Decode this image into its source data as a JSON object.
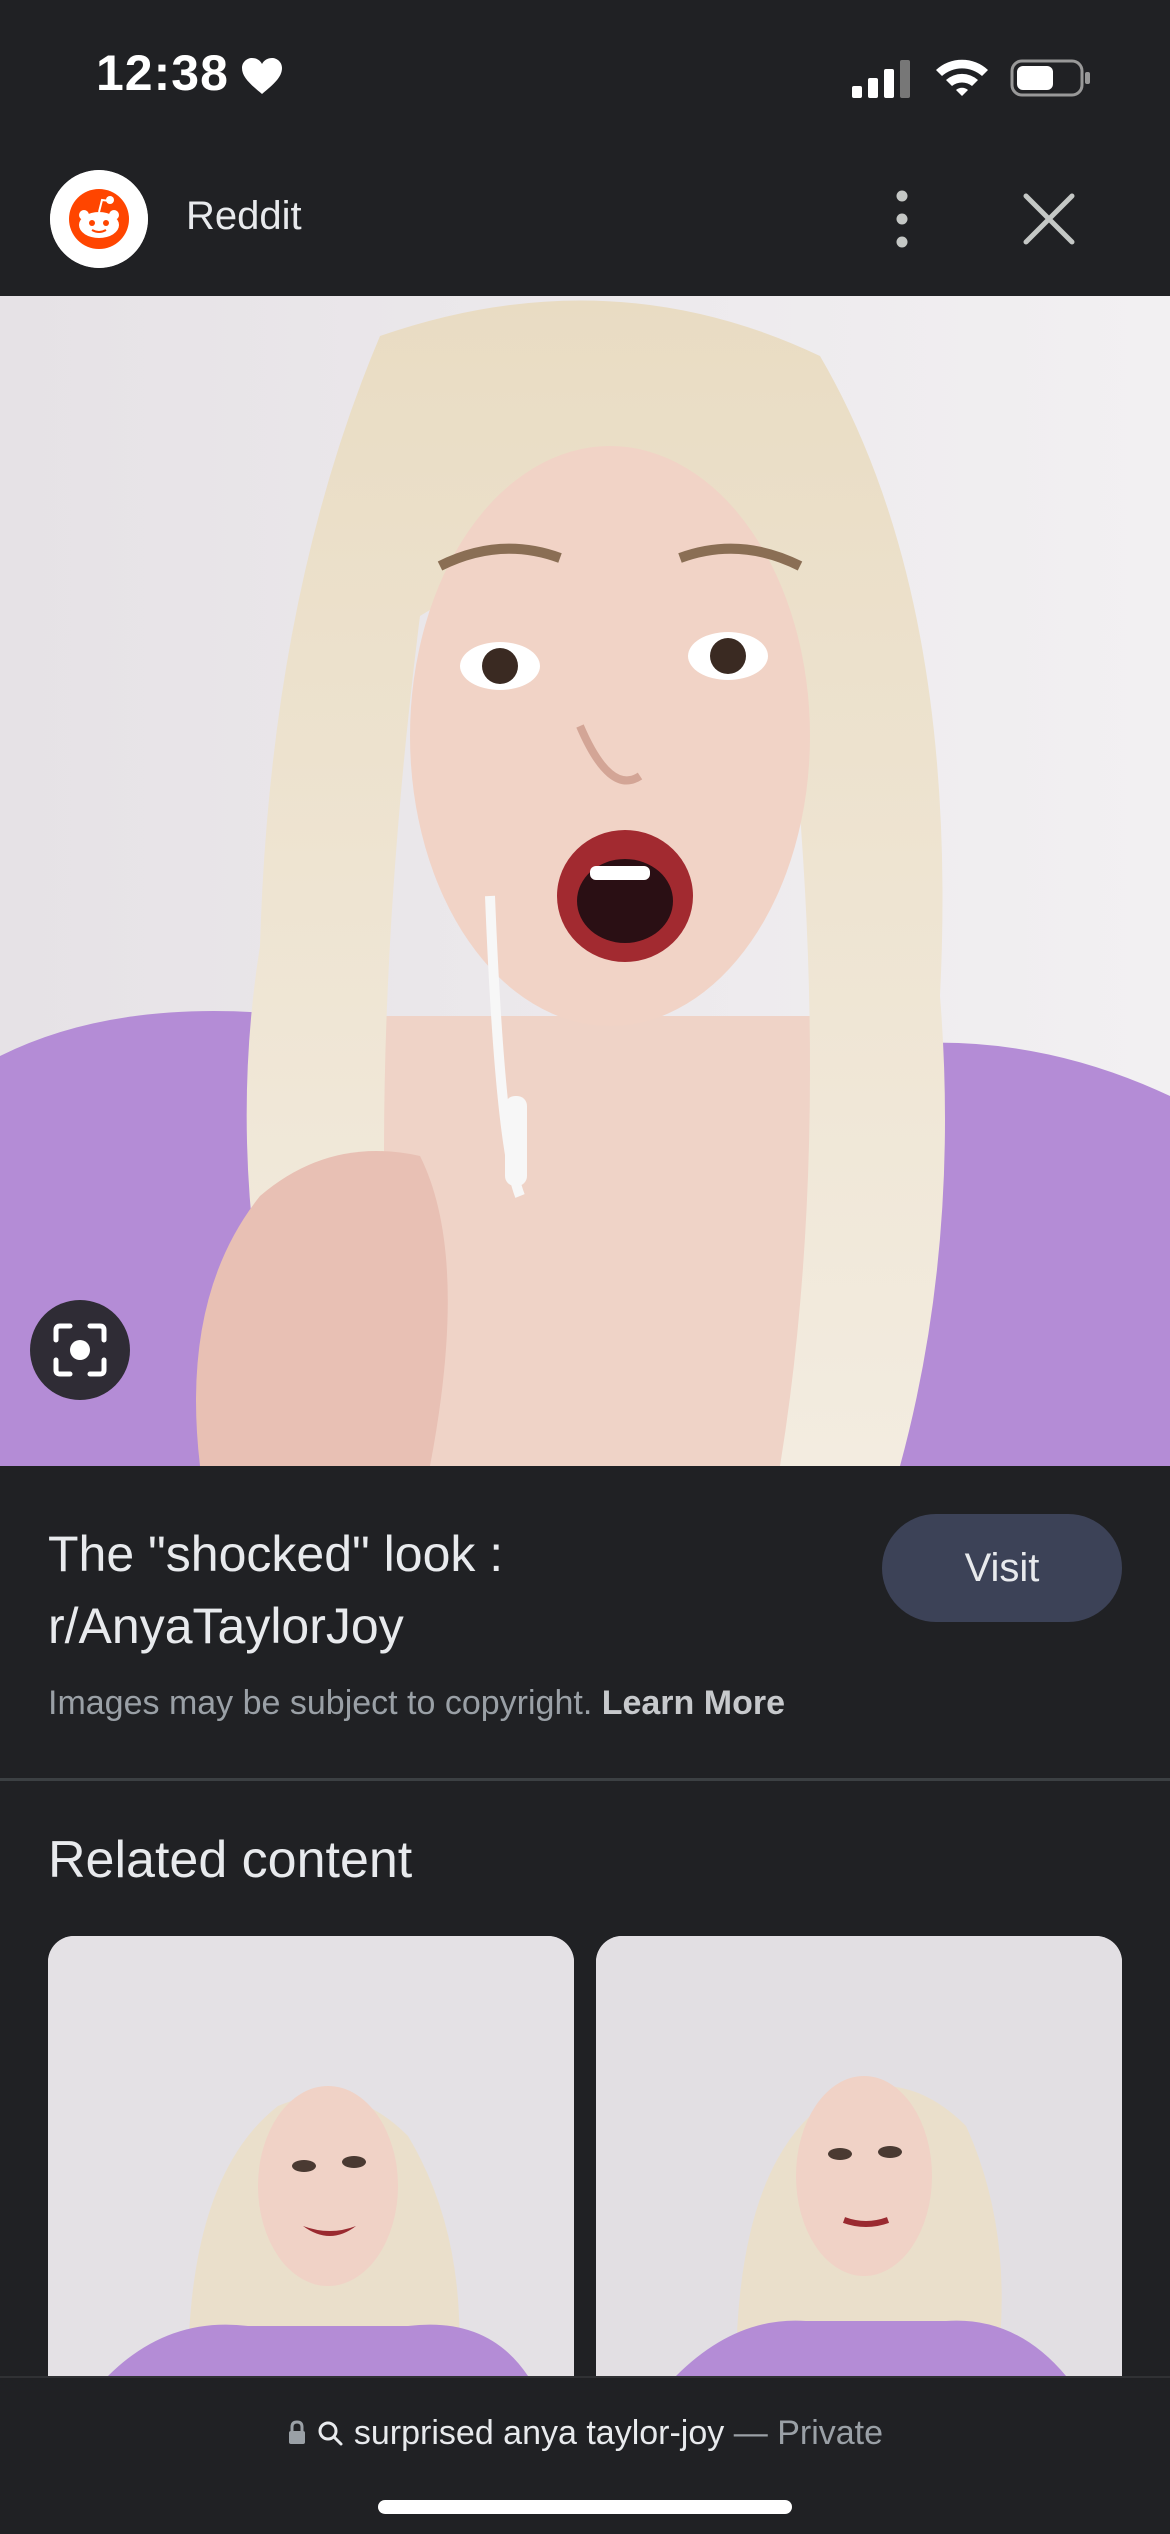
{
  "status": {
    "time": "12:38"
  },
  "header": {
    "site_name": "Reddit"
  },
  "result": {
    "title": "The \"shocked\" look : r/AnyaTaylorJoy",
    "visit_label": "Visit",
    "copyright_text": "Images may be subject to copyright.",
    "learn_more_label": "Learn More"
  },
  "related": {
    "title": "Related content"
  },
  "bottom_bar": {
    "query": "surprised anya taylor-joy",
    "separator": "—",
    "mode": "Private"
  },
  "colors": {
    "background": "#202124",
    "visit_button": "#3c4257",
    "reddit_orange": "#ff4500"
  },
  "icons": [
    "heart-icon",
    "cellular-signal-icon",
    "wifi-icon",
    "battery-icon",
    "reddit-logo",
    "more-vert-icon",
    "close-icon",
    "lens-icon",
    "lock-icon",
    "search-icon"
  ]
}
